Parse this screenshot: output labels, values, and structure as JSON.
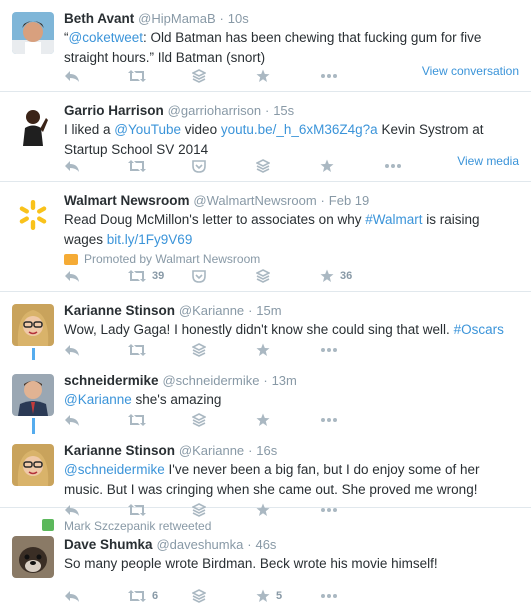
{
  "tweets": [
    {
      "fullname": "Beth Avant",
      "username": "@HipMamaB",
      "dot": "·",
      "time": "10s",
      "text_parts": [
        {
          "t": "“",
          "link": false
        },
        {
          "t": "@coketweet",
          "link": true
        },
        {
          "t": ": Old Batman has been chewing that fucking gum for five straight hours.” Ild Batman (snort)",
          "link": false
        }
      ],
      "more_label": "View conversation"
    },
    {
      "fullname": "Garrio Harrison",
      "username": "@garrioharrison",
      "dot": "·",
      "time": "15s",
      "text_parts": [
        {
          "t": "I liked a ",
          "link": false
        },
        {
          "t": "@YouTube",
          "link": true
        },
        {
          "t": " video ",
          "link": false
        },
        {
          "t": "youtu.be/_h_6xM36Z4g?a",
          "link": true
        },
        {
          "t": " Kevin Systrom at Startup School SV 2014",
          "link": false
        }
      ],
      "more_label": "View media"
    },
    {
      "fullname": "Walmart Newsroom",
      "username": "@WalmartNewsroom",
      "dot": "·",
      "time": "Feb 19",
      "text_parts": [
        {
          "t": "Read Doug McMillon's letter to associates on why ",
          "link": false
        },
        {
          "t": "#Walmart",
          "link": true
        },
        {
          "t": " is raising wages ",
          "link": false
        },
        {
          "t": "bit.ly/1Fy9V69",
          "link": true
        }
      ],
      "promoted": "Promoted by Walmart Newsroom",
      "retweets": "39",
      "favorites": "36"
    },
    {
      "fullname": "Karianne Stinson",
      "username": "@Karianne",
      "dot": "·",
      "time": "15m",
      "text_parts": [
        {
          "t": "Wow, Lady Gaga! I honestly didn't know she could sing that well. ",
          "link": false
        },
        {
          "t": "#Oscars",
          "link": true
        }
      ]
    },
    {
      "fullname": "schneidermike",
      "username": "@schneidermike",
      "dot": "·",
      "time": "13m",
      "text_parts": [
        {
          "t": "@Karianne",
          "link": true
        },
        {
          "t": " she's amazing",
          "link": false
        }
      ]
    },
    {
      "fullname": "Karianne Stinson",
      "username": "@Karianne",
      "dot": "·",
      "time": "16s",
      "text_parts": [
        {
          "t": "@schneidermike",
          "link": true
        },
        {
          "t": " I've never been a big fan, but I do enjoy some of her music. But I was cringing when she came out. She proved me wrong!",
          "link": false
        }
      ]
    },
    {
      "retweeted_by": "Mark Szczepanik retweeted",
      "fullname": "Dave Shumka",
      "username": "@daveshumka",
      "dot": "·",
      "time": "46s",
      "text_parts": [
        {
          "t": "So many people wrote Birdman. Beck wrote his movie himself!",
          "link": false
        }
      ],
      "retweets": "6",
      "favorites": "5"
    }
  ],
  "colors": {
    "link": "#3b94d9",
    "muted": "#8899a6",
    "text": "#292f33",
    "conversation_line": "#55acee"
  },
  "icons": {
    "reply": "reply-icon",
    "retweet": "retweet-icon",
    "pocket": "pocket-icon",
    "buffer": "buffer-icon",
    "favorite": "favorite-icon",
    "more": "more-icon"
  }
}
